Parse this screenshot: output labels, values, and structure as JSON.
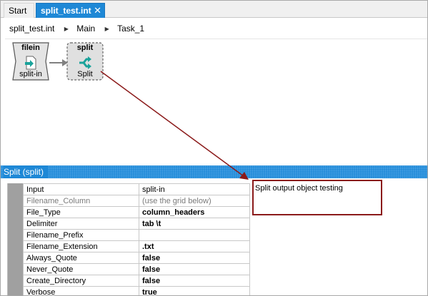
{
  "tabs": [
    {
      "label": "Start",
      "active": false
    },
    {
      "label": "split_test.int",
      "active": true,
      "close_glyph": "✕"
    }
  ],
  "breadcrumb": [
    "split_test.int",
    "Main",
    "Task_1"
  ],
  "canvas": {
    "nodes": [
      {
        "top_label": "filein",
        "bottom_label": "split-in",
        "icon": "file-input-icon"
      },
      {
        "top_label": "split",
        "bottom_label": "Split",
        "icon": "split-icon"
      }
    ]
  },
  "panel": {
    "title": "Split (split)",
    "accent": "#1e88d6"
  },
  "properties": [
    {
      "name": "Input",
      "value": "split-in",
      "muted": false,
      "bold": false
    },
    {
      "name": "Filename_Column",
      "value": "(use the grid below)",
      "muted": true,
      "bold": false
    },
    {
      "name": "File_Type",
      "value": "column_headers",
      "muted": false,
      "bold": true
    },
    {
      "name": "Delimiter",
      "value": "tab \\t",
      "muted": false,
      "bold": true
    },
    {
      "name": "Filename_Prefix",
      "value": "",
      "muted": false,
      "bold": false
    },
    {
      "name": "Filename_Extension",
      "value": ".txt",
      "muted": false,
      "bold": true
    },
    {
      "name": "Always_Quote",
      "value": "false",
      "muted": false,
      "bold": true
    },
    {
      "name": "Never_Quote",
      "value": "false",
      "muted": false,
      "bold": true
    },
    {
      "name": "Create_Directory",
      "value": "false",
      "muted": false,
      "bold": true
    },
    {
      "name": "Verbose",
      "value": "true",
      "muted": false,
      "bold": true
    }
  ],
  "note": {
    "text": "Split output object testing",
    "border_color": "#8b1a1a"
  }
}
